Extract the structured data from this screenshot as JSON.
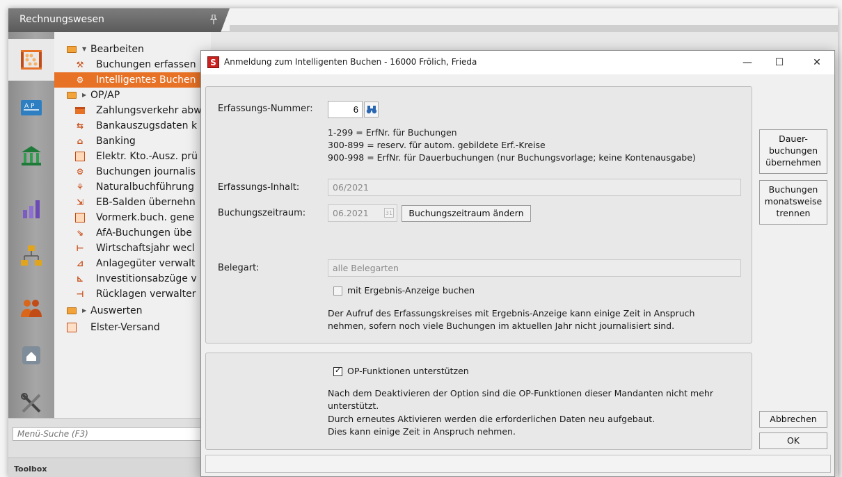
{
  "app": {
    "title": "Rechnungswesen"
  },
  "sidebar": {
    "rail_icons": [
      "accounting-abacus-icon",
      "op-ap-icon",
      "bank-icon",
      "statistics-icon",
      "org-chart-icon",
      "people-icon",
      "home-drive-icon",
      "tools-icon"
    ],
    "tree": [
      {
        "type": "folder",
        "label": "Bearbeiten",
        "expanded": true
      },
      {
        "type": "leaf",
        "label": "Buchungen erfassen"
      },
      {
        "type": "leaf",
        "label": "Intelligentes Buchen",
        "selected": true
      },
      {
        "type": "folder",
        "label": "OP/AP",
        "expanded": false
      },
      {
        "type": "leaf",
        "label": "Zahlungsverkehr abw"
      },
      {
        "type": "leaf",
        "label": "Bankauszugsdaten k"
      },
      {
        "type": "leaf",
        "label": "Banking"
      },
      {
        "type": "leaf",
        "label": "Elektr. Kto.-Ausz. prü"
      },
      {
        "type": "leaf",
        "label": "Buchungen journalis"
      },
      {
        "type": "leaf",
        "label": "Naturalbuchführung"
      },
      {
        "type": "leaf",
        "label": "EB-Salden übernehn"
      },
      {
        "type": "leaf",
        "label": "Vormerk.buch. gene"
      },
      {
        "type": "leaf",
        "label": "AfA-Buchungen übe"
      },
      {
        "type": "leaf",
        "label": "Wirtschaftsjahr wecl"
      },
      {
        "type": "leaf",
        "label": "Anlagegüter verwalt"
      },
      {
        "type": "leaf",
        "label": "Investitionsabzüge v"
      },
      {
        "type": "leaf",
        "label": "Rücklagen verwalter"
      },
      {
        "type": "folder",
        "label": "Auswerten",
        "expanded": false
      },
      {
        "type": "leaf-top",
        "label": "Elster-Versand"
      }
    ],
    "search_placeholder": "Menü-Suche (F3)",
    "toolbox_label": "Toolbox"
  },
  "dialog": {
    "logo_letter": "S",
    "title": "Anmeldung zum Intelligenten Buchen - 16000 Frölich, Frieda",
    "controls": {
      "minimize": "—",
      "maximize": "☐",
      "close": "✕"
    },
    "erfassungs_nummer": {
      "label": "Erfassungs-Nummer:",
      "value": "6",
      "help": [
        "1-299 = ErfNr. für Buchungen",
        "300-899 = reserv. für autom. gebildete Erf.-Kreise",
        "900-998 = ErfNr. für Dauerbuchungen (nur Buchungsvorlage; keine Kontenausgabe)"
      ]
    },
    "erfassungs_inhalt": {
      "label": "Erfassungs-Inhalt:",
      "value": "06/2021"
    },
    "buchungszeitraum": {
      "label": "Buchungszeitraum:",
      "value": "06.2021",
      "calendar_day": "31",
      "change_button": "Buchungszeitraum ändern"
    },
    "belegart": {
      "label": "Belegart:",
      "value": "alle Belegarten"
    },
    "ergebnis_checkbox": {
      "label": "mit Ergebnis-Anzeige buchen",
      "checked": false
    },
    "ergebnis_hint": [
      "Der Aufruf des Erfassungskreises mit Ergebnis-Anzeige kann einige Zeit in Anspruch",
      "nehmen, sofern noch viele Buchungen im aktuellen Jahr nicht journalisiert sind."
    ],
    "op_checkbox": {
      "label": "OP-Funktionen unterstützen",
      "checked": true
    },
    "op_hint": [
      "Nach dem Deaktivieren der Option sind die OP-Funktionen dieser Mandanten nicht mehr",
      "unterstützt.",
      "Durch erneutes Aktivieren werden die erforderlichen Daten neu aufgebaut.",
      "Dies kann einige Zeit in Anspruch nehmen."
    ],
    "side_buttons": {
      "dauer": [
        "Dauer-",
        "buchungen",
        "übernehmen"
      ],
      "monat": [
        "Buchungen",
        "monatsweise",
        "trennen"
      ]
    },
    "cancel_button": "Abbrechen",
    "ok_button": "OK"
  }
}
